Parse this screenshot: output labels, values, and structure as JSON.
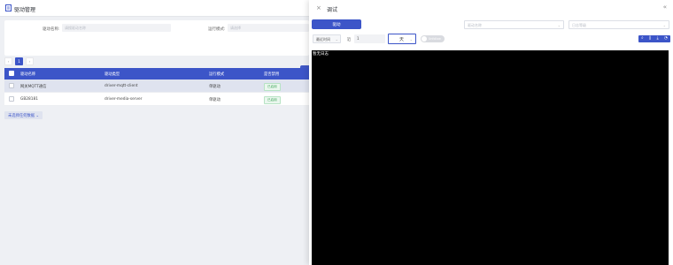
{
  "page": {
    "icon": "menu-book-icon",
    "title": "驱动管理"
  },
  "filters": {
    "driver_name_label": "驱动名称:",
    "driver_name_placeholder": "请搜驱动名称",
    "run_mode_label": "运行模式:",
    "run_mode_placeholder": "请选择"
  },
  "pagination": {
    "prev": "‹",
    "current": "1",
    "next": "›"
  },
  "table": {
    "headers": [
      "驱动名称",
      "驱动类型",
      "运行模式",
      "是否禁用"
    ],
    "rows": [
      {
        "name": "网关MQTT通信",
        "type": "driver-mqtt-client",
        "mode": "单驱动",
        "status": "已启用",
        "selected": true
      },
      {
        "name": "GB28181",
        "type": "driver-media-server",
        "mode": "单驱动",
        "status": "已启用",
        "selected": false
      }
    ],
    "bulk_action": "未选择任何数据"
  },
  "drawer": {
    "title": "调试",
    "start_button": "驱动",
    "driver_select_placeholder": "驱动名称",
    "log_level_placeholder": "日志等级",
    "time_select": "最近时间",
    "near_label": "近",
    "near_value": "1",
    "unit_value": "天",
    "toggle_label": "Unfollow",
    "console_text": "暂无日志"
  },
  "colors": {
    "primary": "#3c55c8",
    "console_bg": "#000000",
    "badge_green": "#3aa356"
  }
}
